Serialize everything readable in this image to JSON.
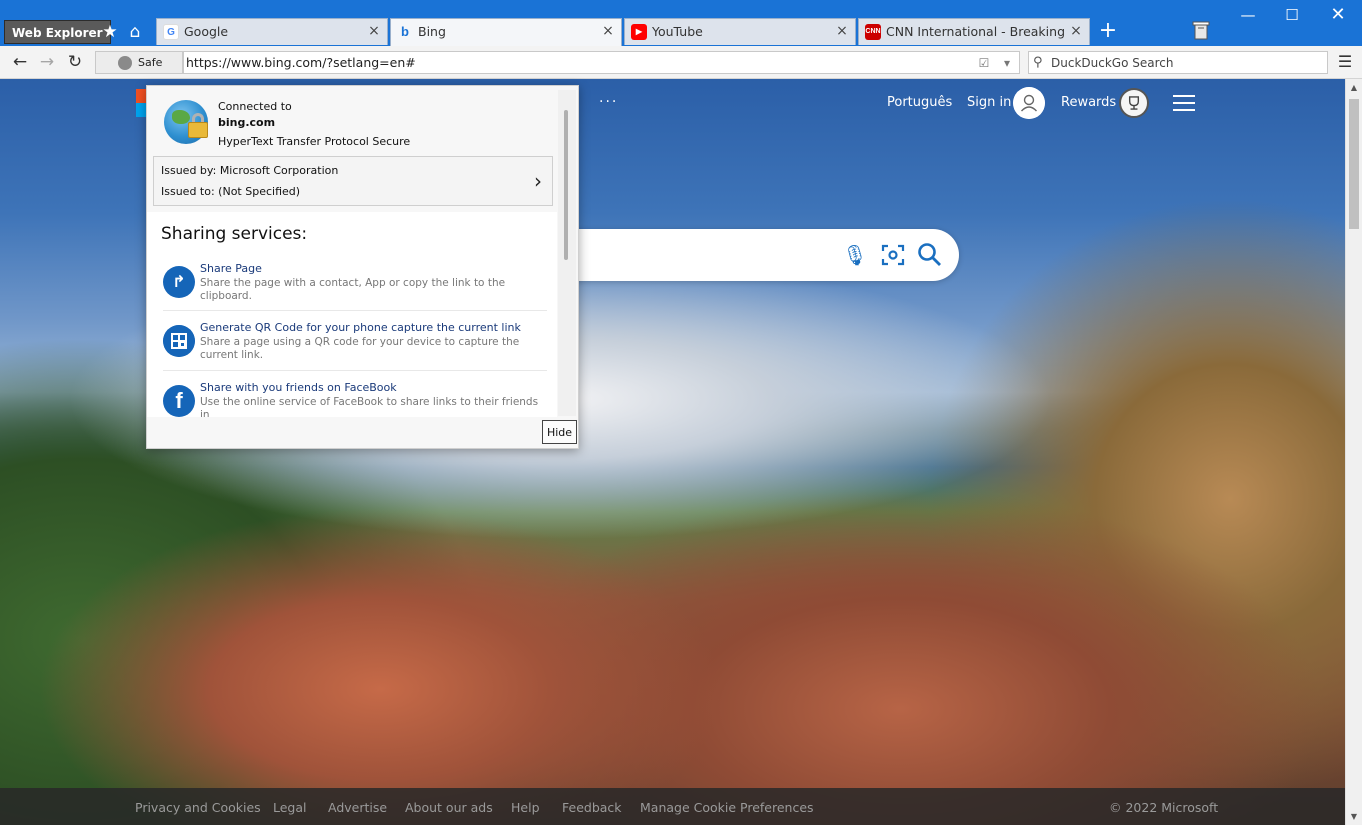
{
  "app": {
    "name": "Web Explorer",
    "tabs": [
      {
        "label": "Google",
        "favicon": "google-icon",
        "active": false
      },
      {
        "label": "Bing",
        "favicon": "bing-icon",
        "active": true
      },
      {
        "label": "YouTube",
        "favicon": "youtube-icon",
        "active": false
      },
      {
        "label": "CNN International - Breaking News",
        "favicon": "cnn-icon",
        "active": false
      }
    ],
    "tab_close": "×",
    "new_tab": "+"
  },
  "navbar": {
    "security_label": "Safe",
    "url": "https://www.bing.com/?setlang=en#",
    "search_placeholder": "DuckDuckGo Search"
  },
  "bing": {
    "more_dots": "···",
    "language_link": "Português",
    "sign_in": "Sign in",
    "rewards": "Rewards",
    "colors": {
      "logo_red": "#f25022",
      "logo_blue": "#00a4ef",
      "accent": "#1a6fc0"
    }
  },
  "footer": {
    "links": [
      "Privacy and Cookies",
      "Legal",
      "Advertise",
      "About our ads",
      "Help",
      "Feedback",
      "Manage Cookie Preferences"
    ],
    "copyright": "© 2022 Microsoft"
  },
  "security_popup": {
    "connected_to": "Connected to",
    "host": "bing.com",
    "protocol": "HyperText Transfer Protocol Secure",
    "issued_by": "Issued by: Microsoft Corporation",
    "issued_to": "Issued to: (Not Specified)",
    "sharing_title": "Sharing services:",
    "services": [
      {
        "name": "Share Page",
        "description": "Share the page with a contact, App or copy the link to the clipboard.",
        "icon": "share-arrow-icon"
      },
      {
        "name": "Generate QR Code for your phone capture the current link",
        "description": "Share a page using a QR code for your device to capture the current link.",
        "icon": "qr-code-icon"
      },
      {
        "name": "Share with you friends on FaceBook",
        "description": "Use the online service of FaceBook to share links to their friends in",
        "icon": "facebook-icon"
      }
    ],
    "hide_label": "Hide"
  }
}
